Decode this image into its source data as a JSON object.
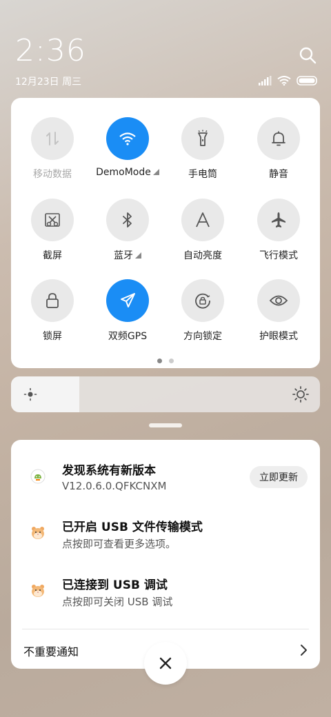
{
  "status": {
    "time": "2:36",
    "date": "12月23日 周三",
    "icons": [
      "signal-icon",
      "wifi-icon",
      "battery-icon"
    ]
  },
  "search": {
    "icon": "search-icon"
  },
  "control_center": {
    "tiles": [
      {
        "label": "移动数据",
        "icon": "mobile-data-icon",
        "active": false,
        "disabled": true,
        "has_menu": false
      },
      {
        "label": "DemoMode",
        "icon": "wifi-icon",
        "active": true,
        "disabled": false,
        "has_menu": true
      },
      {
        "label": "手电筒",
        "icon": "flashlight-icon",
        "active": false,
        "disabled": false,
        "has_menu": false
      },
      {
        "label": "静音",
        "icon": "bell-icon",
        "active": false,
        "disabled": false,
        "has_menu": false
      },
      {
        "label": "截屏",
        "icon": "screenshot-icon",
        "active": false,
        "disabled": false,
        "has_menu": false
      },
      {
        "label": "蓝牙",
        "icon": "bluetooth-icon",
        "active": false,
        "disabled": false,
        "has_menu": true
      },
      {
        "label": "自动亮度",
        "icon": "auto-brightness-icon",
        "active": false,
        "disabled": false,
        "has_menu": false
      },
      {
        "label": "飞行模式",
        "icon": "airplane-icon",
        "active": false,
        "disabled": false,
        "has_menu": false
      },
      {
        "label": "锁屏",
        "icon": "lock-icon",
        "active": false,
        "disabled": false,
        "has_menu": false
      },
      {
        "label": "双频GPS",
        "icon": "location-arrow-icon",
        "active": true,
        "disabled": false,
        "has_menu": false
      },
      {
        "label": "方向锁定",
        "icon": "rotation-lock-icon",
        "active": false,
        "disabled": false,
        "has_menu": false
      },
      {
        "label": "护眼模式",
        "icon": "eye-icon",
        "active": false,
        "disabled": false,
        "has_menu": false
      }
    ],
    "page_count": 2,
    "current_page": 1
  },
  "brightness": {
    "level": 0.22
  },
  "notifications": {
    "items": [
      {
        "title": "发现系统有新版本",
        "subtitle": "V12.0.6.0.QFKCNXM",
        "icon": "android-update-icon",
        "action": "立即更新"
      },
      {
        "title": "已开启 USB 文件传输模式",
        "subtitle": "点按即可查看更多选项。",
        "icon": "hamster-icon"
      },
      {
        "title": "已连接到 USB 调试",
        "subtitle": "点按即可关闭 USB 调试",
        "icon": "hamster-icon"
      }
    ],
    "unimportant_label": "不重要通知"
  },
  "colors": {
    "accent": "#1a8df5",
    "tile_bg": "#e9e9e9",
    "text": "#222222"
  }
}
